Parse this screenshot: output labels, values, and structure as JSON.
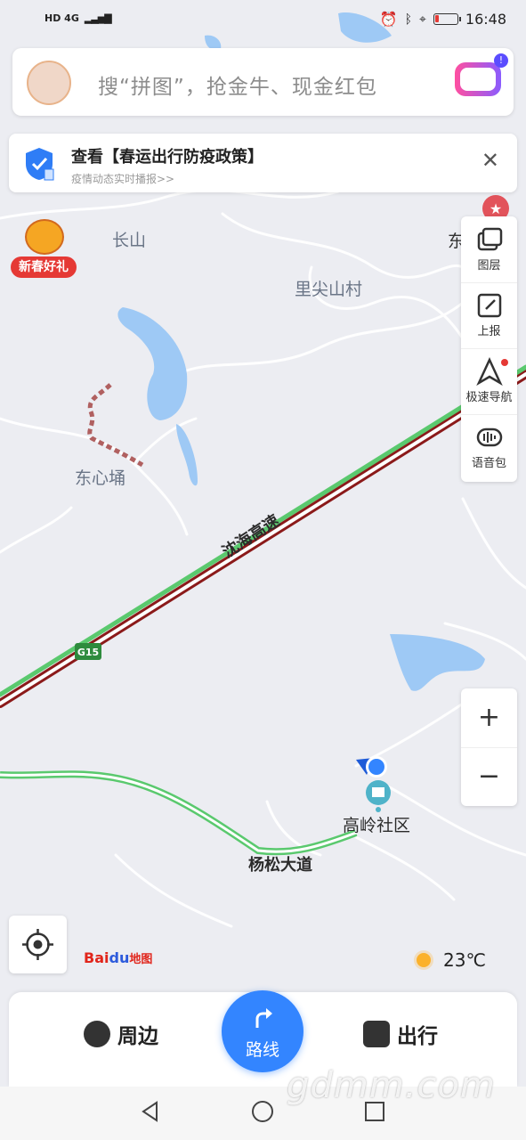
{
  "status_bar": {
    "left_text": "HD 4G",
    "time": "16:48"
  },
  "search": {
    "placeholder": "搜“拼图”，抢金牛、现金红包"
  },
  "notice": {
    "title": "查看【春运出行防疫政策】",
    "subtitle": "疫情动态实时播报>>"
  },
  "promo": {
    "label": "新春好礼"
  },
  "tools": [
    {
      "label": "图层",
      "icon": "layers-icon"
    },
    {
      "label": "上报",
      "icon": "report-icon"
    },
    {
      "label": "极速导航",
      "icon": "navigation-icon"
    },
    {
      "label": "语音包",
      "icon": "voice-pack-icon"
    }
  ],
  "zoom": {
    "in": "+",
    "out": "−"
  },
  "map_labels": {
    "changshan": "长山",
    "lijianshan": "里尖山村",
    "dongxinyong": "东心埇",
    "highway": "沈海高速",
    "highway_code": "G15",
    "gaoling": "高岭社区",
    "yangsong": "杨松大道",
    "edge_partial": "东"
  },
  "logo": {
    "bai": "Bai",
    "du": "du",
    "map": "地图"
  },
  "weather": {
    "temp": "23℃"
  },
  "bottom": {
    "nearby": "周边",
    "route": "路线",
    "travel": "出行"
  },
  "watermark": "gdmm.com",
  "colors": {
    "accent": "#3385ff",
    "route_green": "#5ac96e",
    "highway_red": "#c62828",
    "water": "#9ec9f5"
  }
}
